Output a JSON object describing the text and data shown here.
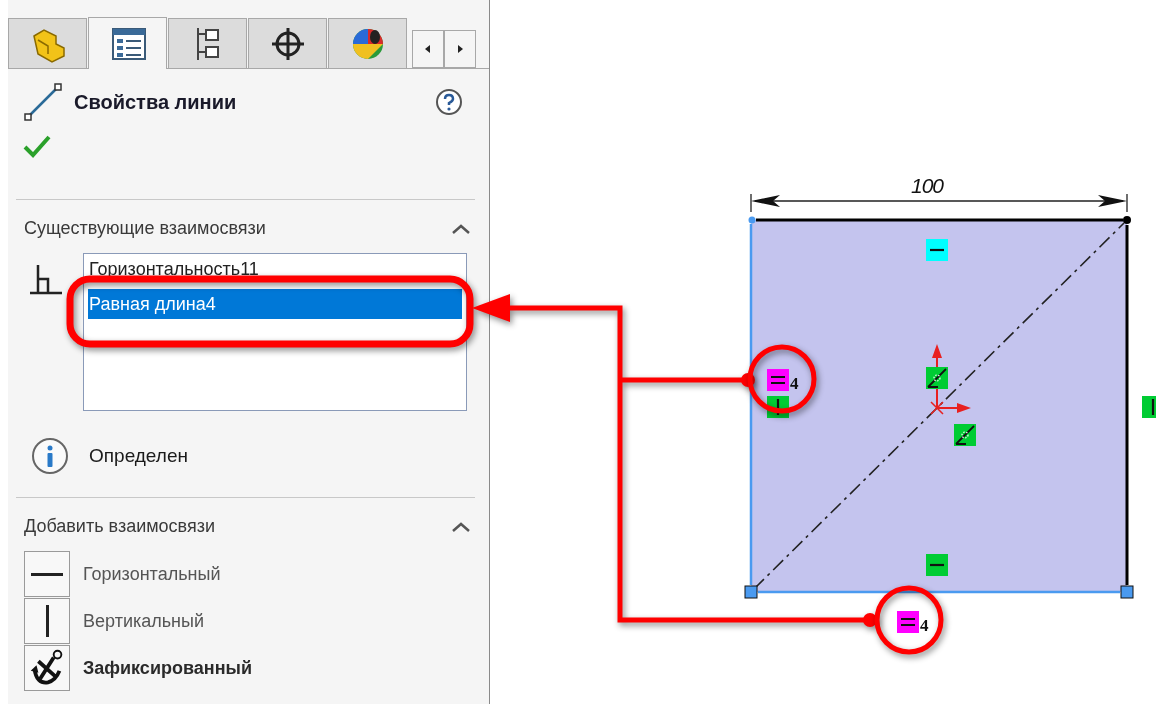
{
  "tabs": [
    {
      "kind": "feature",
      "selected": false
    },
    {
      "kind": "property",
      "selected": true
    },
    {
      "kind": "config",
      "selected": false
    },
    {
      "kind": "target",
      "selected": false
    },
    {
      "kind": "display",
      "selected": false
    }
  ],
  "panel": {
    "title": "Свойства линии"
  },
  "existing_relations": {
    "title": "Существующие взаимосвязи",
    "expanded": true,
    "items": [
      {
        "label": "Горизонтальность11",
        "selected": false
      },
      {
        "label": "Равная длина4",
        "selected": true
      }
    ],
    "status": "Определен"
  },
  "add_relations": {
    "title": "Добавить взаимосвязи",
    "expanded": true,
    "items": [
      {
        "kind": "horizontal",
        "label": "Горизонтальный"
      },
      {
        "kind": "vertical",
        "label": "Вертикальный"
      },
      {
        "kind": "fix",
        "label": "Зафиксированный"
      }
    ]
  },
  "sketch": {
    "dimension": "100",
    "relations": [
      {
        "kind": "horizontal",
        "color": "#00ffff"
      },
      {
        "kind": "equal",
        "color": "#ff00ff",
        "label": "4"
      },
      {
        "kind": "vertical",
        "color": "#00cc33"
      },
      {
        "kind": "coincident",
        "color": "#00cc33"
      },
      {
        "kind": "coincident",
        "color": "#00cc33"
      },
      {
        "kind": "horizontal",
        "color": "#00cc33"
      },
      {
        "kind": "equal",
        "color": "#ff00ff",
        "label": "4"
      },
      {
        "kind": "vertical",
        "color": "#00cc33"
      }
    ]
  }
}
